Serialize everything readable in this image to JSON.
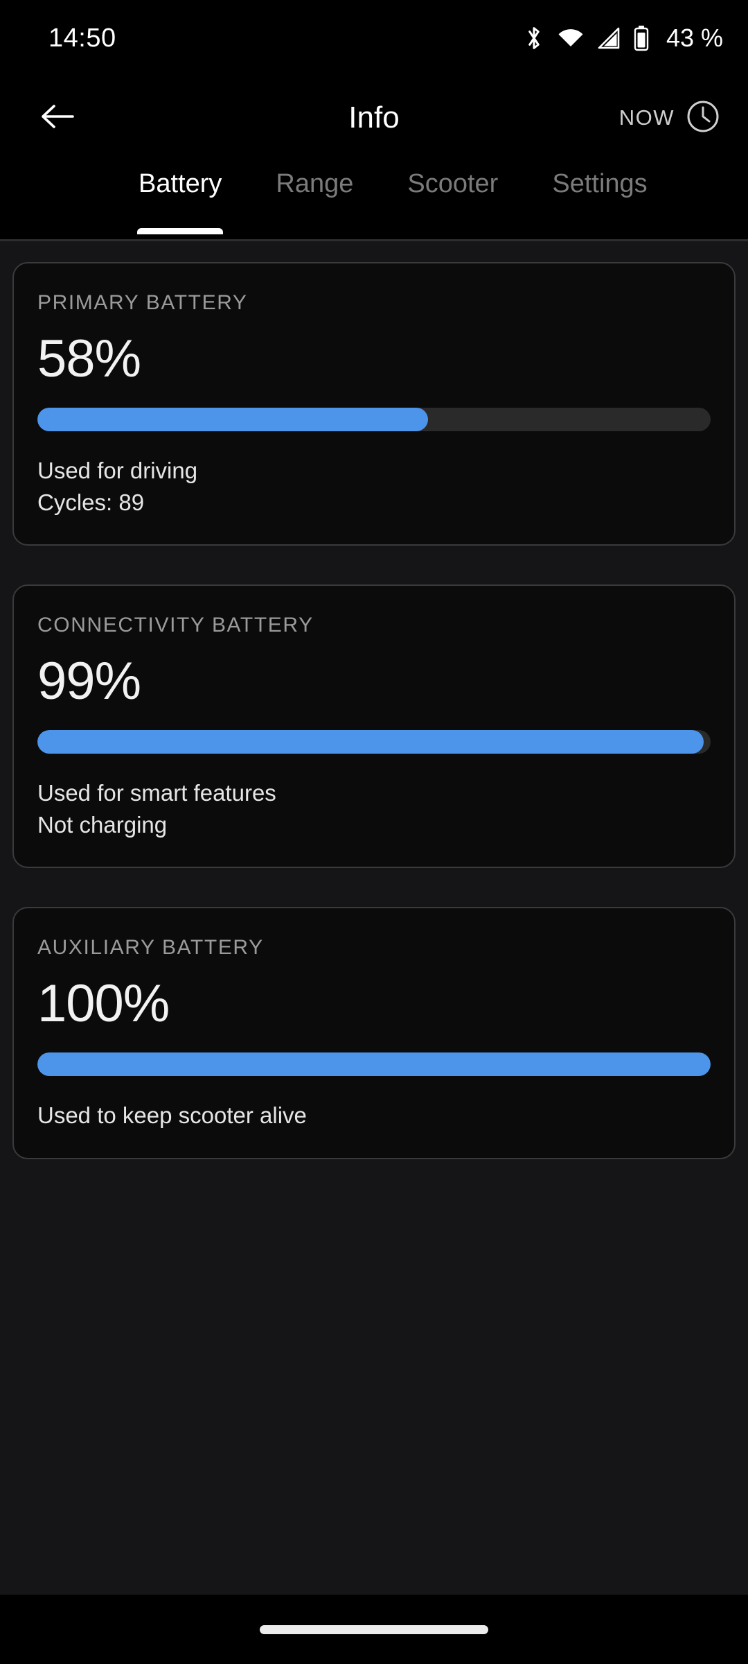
{
  "status_bar": {
    "time": "14:50",
    "battery_percent": "43 %",
    "icons": [
      "bluetooth-icon",
      "wifi-icon",
      "cellular-signal-icon",
      "battery-icon"
    ]
  },
  "app_bar": {
    "back_icon": "back-arrow-icon",
    "title": "Info",
    "now_label": "NOW",
    "clock_icon": "clock-icon"
  },
  "tabs": [
    {
      "label": "Battery",
      "active": true
    },
    {
      "label": "Range",
      "active": false
    },
    {
      "label": "Scooter",
      "active": false
    },
    {
      "label": "Settings",
      "active": false
    }
  ],
  "cards": [
    {
      "label": "PRIMARY BATTERY",
      "value": "58%",
      "percent": 58,
      "notes": [
        "Used for driving",
        "Cycles: 89"
      ]
    },
    {
      "label": "CONNECTIVITY BATTERY",
      "value": "99%",
      "percent": 99,
      "notes": [
        "Used for smart features",
        "Not charging"
      ]
    },
    {
      "label": "AUXILIARY BATTERY",
      "value": "100%",
      "percent": 100,
      "notes": [
        "Used to keep scooter alive"
      ]
    }
  ],
  "nav_bar": {
    "home_indicator": "home-indicator"
  },
  "colors": {
    "accent": "#4d95ea",
    "track": "#2a2a2a",
    "background": "#151517",
    "card_background": "#0b0b0c",
    "card_border": "#3a3a3c",
    "label": "#9b9b9b",
    "text": "#e6e6e6",
    "tab_inactive": "#7b7b7b"
  }
}
